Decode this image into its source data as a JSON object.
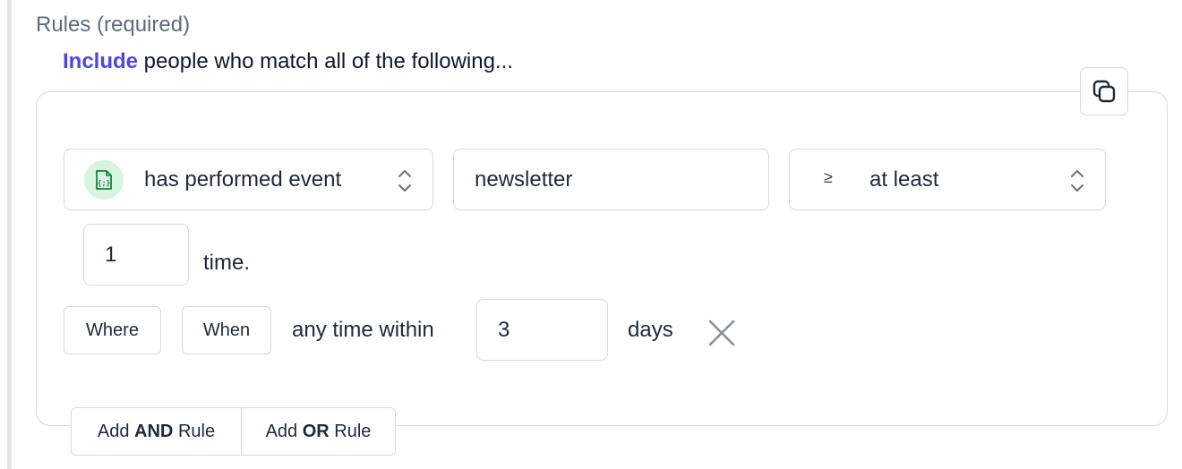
{
  "section": {
    "title": "Rules (required)",
    "include_word": "Include",
    "include_rest": " people who match all of the following..."
  },
  "rule": {
    "condition_select": {
      "icon": "event-code-icon",
      "label": "has performed event"
    },
    "event_name": "newsletter",
    "operator_select": {
      "symbol": "≥",
      "label": "at least"
    },
    "count": "1",
    "count_suffix": "time.",
    "where_label": "Where",
    "when_label": "When",
    "time_phrase": "any time within",
    "days_value": "3",
    "days_suffix": "days"
  },
  "actions": {
    "add_and_prefix": "Add ",
    "add_and_bold": "AND",
    "add_and_suffix": " Rule",
    "add_or_prefix": "Add ",
    "add_or_bold": "OR",
    "add_or_suffix": " Rule"
  },
  "colors": {
    "accent": "#4f46e5",
    "event_badge_bg": "#d9f3e1",
    "event_icon": "#15803d",
    "border": "#d6dae0"
  }
}
